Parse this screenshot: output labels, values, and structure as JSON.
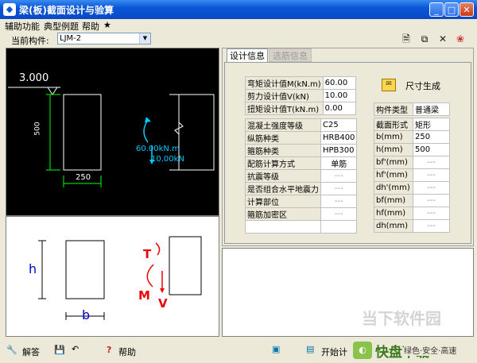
{
  "window": {
    "title": "梁(板)截面设计与验算",
    "min": "_",
    "max": "□",
    "close": "✕"
  },
  "menu": [
    "辅助功能",
    "典型例题",
    "帮助",
    "★"
  ],
  "member": {
    "label": "当前构件:",
    "value": "LJM-2"
  },
  "drawing": {
    "elev": "3.000",
    "height_dim": "500",
    "width_dim": "250",
    "moment": "60.00kN.m",
    "shear": "10.00kN"
  },
  "schematic": {
    "h": "h",
    "b": "b",
    "T": "T",
    "M": "M",
    "V": "V"
  },
  "tabs": [
    {
      "label": "设计信息"
    },
    {
      "label": "选筋信息"
    }
  ],
  "design_rows": [
    {
      "label": "弯矩设计值M(kN.m)",
      "value": "60.00"
    },
    {
      "label": "剪力设计值V(kN)",
      "value": "10.00"
    },
    {
      "label": "扭矩设计值T(kN.m)",
      "value": "0.00"
    }
  ],
  "material_rows": [
    {
      "label": "混凝土强度等级",
      "value": "C25"
    },
    {
      "label": "纵筋种类",
      "value": "HRB400"
    },
    {
      "label": "箍筋种类",
      "value": "HPB300"
    },
    {
      "label": "配筋计算方式",
      "value": "单筋"
    },
    {
      "label": "抗震等级",
      "value": "---"
    },
    {
      "label": "是否组合水平地震力",
      "value": "---"
    },
    {
      "label": "计算部位",
      "value": "---"
    },
    {
      "label": "箍筋加密区",
      "value": "---"
    }
  ],
  "size_button": "尺寸生成",
  "member_type": {
    "label": "构件类型",
    "value": "普通梁"
  },
  "section_rows": [
    {
      "label": "截面形式",
      "value": "矩形"
    },
    {
      "label": "b(mm)",
      "value": "250"
    },
    {
      "label": "h(mm)",
      "value": "500"
    },
    {
      "label": "bf'(mm)",
      "value": "---"
    },
    {
      "label": "hf'(mm)",
      "value": "---"
    },
    {
      "label": "dh'(mm)",
      "value": "---"
    },
    {
      "label": "bf(mm)",
      "value": "---"
    },
    {
      "label": "hf(mm)",
      "value": "---"
    },
    {
      "label": "dh(mm)",
      "value": "---"
    }
  ],
  "status": {
    "answer": "解答",
    "help": "帮助",
    "start": "开始计",
    "watermark1": "当下软件园",
    "watermark2": "快盘下载",
    "watermark3": "绿色·安全·高速"
  }
}
